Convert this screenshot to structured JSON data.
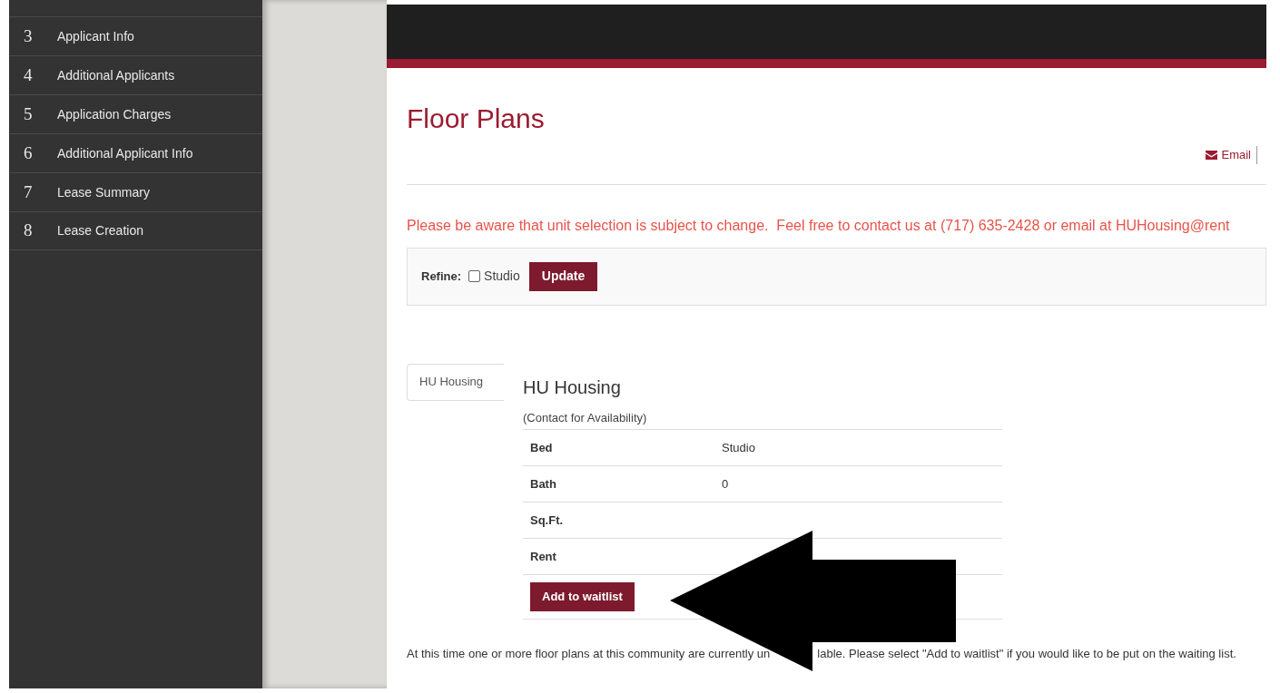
{
  "sidebar": {
    "items": [
      {
        "number": "3",
        "label": "Applicant Info"
      },
      {
        "number": "4",
        "label": "Additional Applicants"
      },
      {
        "number": "5",
        "label": "Application Charges"
      },
      {
        "number": "6",
        "label": "Additional Applicant Info"
      },
      {
        "number": "7",
        "label": "Lease Summary"
      },
      {
        "number": "8",
        "label": "Lease Creation"
      }
    ]
  },
  "page": {
    "title": "Floor Plans",
    "email_link": "Email",
    "notice": "Please be aware that unit selection is subject to change.  Feel free to contact us at (717) 635-2428 or email at HUHousing@rent"
  },
  "refine": {
    "label": "Refine:",
    "options": [
      {
        "label": "Studio",
        "checked": false
      }
    ],
    "button": "Update"
  },
  "tabs": [
    {
      "label": "HU Housing",
      "selected": true
    }
  ],
  "floor_plan": {
    "name": "HU Housing",
    "availability": "(Contact for Availability)",
    "rows": [
      {
        "label": "Bed",
        "value": "Studio"
      },
      {
        "label": "Bath",
        "value": "0"
      },
      {
        "label": "Sq.Ft."
      },
      {
        "label": "Rent"
      }
    ],
    "button": "Add to waitlist"
  },
  "footer_note": [
    "At this time one or more floor plans at this community are currently un",
    "lable. Please select \"Add to waitlist\" if you would like to be put on the waiting list."
  ]
}
